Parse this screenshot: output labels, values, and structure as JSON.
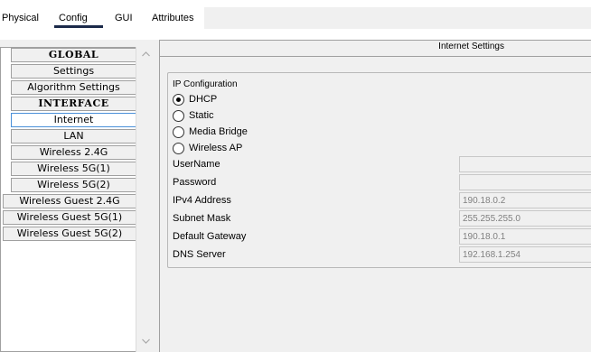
{
  "tabs": [
    {
      "label": "Physical"
    },
    {
      "label": "Config"
    },
    {
      "label": "GUI"
    },
    {
      "label": "Attributes"
    }
  ],
  "sidebar": {
    "items": [
      {
        "label": "GLOBAL"
      },
      {
        "label": "Settings"
      },
      {
        "label": "Algorithm Settings"
      },
      {
        "label": "INTERFACE"
      },
      {
        "label": "Internet"
      },
      {
        "label": "LAN"
      },
      {
        "label": "Wireless 2.4G"
      },
      {
        "label": "Wireless 5G(1)"
      },
      {
        "label": "Wireless 5G(2)"
      },
      {
        "label": "Wireless Guest 2.4G"
      },
      {
        "label": "Wireless Guest 5G(1)"
      },
      {
        "label": "Wireless Guest 5G(2)"
      }
    ],
    "selected": "Internet"
  },
  "panel": {
    "title": "Internet Settings",
    "ip_config_label": "IP Configuration",
    "modes": [
      {
        "label": "DHCP",
        "checked": true
      },
      {
        "label": "Static",
        "checked": false
      },
      {
        "label": "Media Bridge",
        "checked": false
      },
      {
        "label": "Wireless AP",
        "checked": false
      }
    ],
    "fields": [
      {
        "label": "UserName",
        "value": ""
      },
      {
        "label": "Password",
        "value": ""
      },
      {
        "label": "IPv4 Address",
        "value": "190.18.0.2"
      },
      {
        "label": "Subnet Mask",
        "value": "255.255.255.0"
      },
      {
        "label": "Default Gateway",
        "value": "190.18.0.1"
      },
      {
        "label": "DNS Server",
        "value": "192.168.1.254"
      }
    ]
  },
  "icons": {
    "scroll_up": "chevron-up-icon",
    "scroll_down": "chevron-down-icon"
  },
  "colors": {
    "active_tab_underline": "#1b2a4a",
    "selection_border": "#4a90d9",
    "panel_bg": "#f0f0f0"
  }
}
